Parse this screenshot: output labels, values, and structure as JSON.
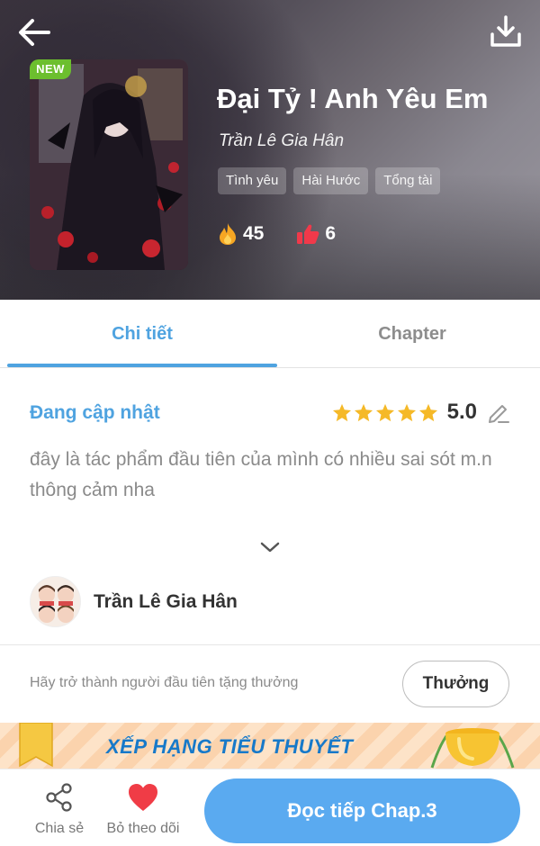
{
  "header": {
    "badge": "NEW",
    "title": "Đại Tỷ ! Anh Yêu Em",
    "author": "Trần Lê Gia Hân",
    "tags": [
      "Tình yêu",
      "Hài Hước",
      "Tổng tài"
    ],
    "stats": {
      "hot": "45",
      "likes": "6"
    }
  },
  "tabs": [
    {
      "label": "Chi tiết",
      "active": true
    },
    {
      "label": "Chapter",
      "active": false
    }
  ],
  "detail": {
    "status": "Đang cập nhật",
    "rating": "5.0",
    "rating_stars": 5,
    "description": "đây là tác phẩm đầu tiên của mình có nhiều sai sót m.n thông cảm nha",
    "author_name": "Trần Lê Gia Hân"
  },
  "reward": {
    "text": "Hãy trở thành người đầu tiên tặng thưởng",
    "button": "Thưởng"
  },
  "banner": {
    "text": "XẾP HẠNG TIỂU THUYẾT"
  },
  "bottom": {
    "share": "Chia sẻ",
    "unfollow": "Bỏ theo dõi",
    "read": "Đọc tiếp Chap.3"
  },
  "colors": {
    "accent": "#4fa3e0",
    "button": "#5aaaf0",
    "badge": "#6cbf2e",
    "star": "#f5b928",
    "heart": "#f03c46"
  }
}
